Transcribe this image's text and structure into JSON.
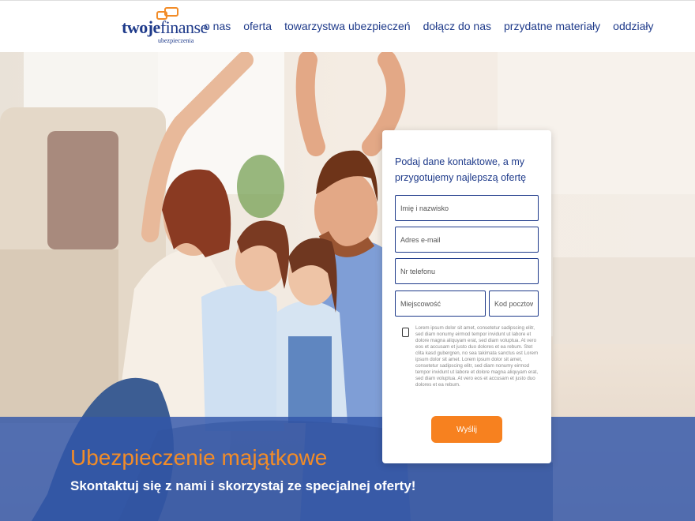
{
  "logo": {
    "bold": "twoje",
    "regular": "finanse",
    "sub": "ubezpieczenia"
  },
  "nav": [
    "o nas",
    "oferta",
    "towarzystwa ubezpieczeń",
    "dołącz do nas",
    "przydatne materiały",
    "oddziały"
  ],
  "hero": {
    "title": "Ubezpieczenie majątkowe",
    "subtitle": "Skontaktuj się z nami i skorzystaj ze specjalnej oferty!"
  },
  "form": {
    "title": "Podaj dane kontaktowe, a my przygotujemy najlepszą ofertę",
    "name_placeholder": "Imię i nazwisko",
    "email_placeholder": "Adres e-mail",
    "phone_placeholder": "Nr telefonu",
    "city_placeholder": "Miejscowość",
    "zip_placeholder": "Kod pocztowy",
    "consent": "Lorem ipsum dolor sit amet, consetetur sadipscing elitr, sed diam nonumy eirmod tempor invidunt ut labore et dolore magna aliquyam erat, sed diam voluptua. At vero eos et accusam et justo duo dolores et ea rebum. Stet clita kasd gubergren, no sea takimata sanctus est Lorem ipsum dolor sit amet. Lorem ipsum dolor sit amet, consetetur sadipscing elitr, sed diam nonumy eirmod tempor invidunt ut labore et dolore magna aliquyam erat, sed diam voluptua. At vero eos et accusam et justo duo dolores et ea rebum.",
    "submit": "Wyślij"
  },
  "colors": {
    "brand_blue": "#1e3a8a",
    "accent_orange": "#f7811f",
    "band_blue": "#3155aa"
  }
}
